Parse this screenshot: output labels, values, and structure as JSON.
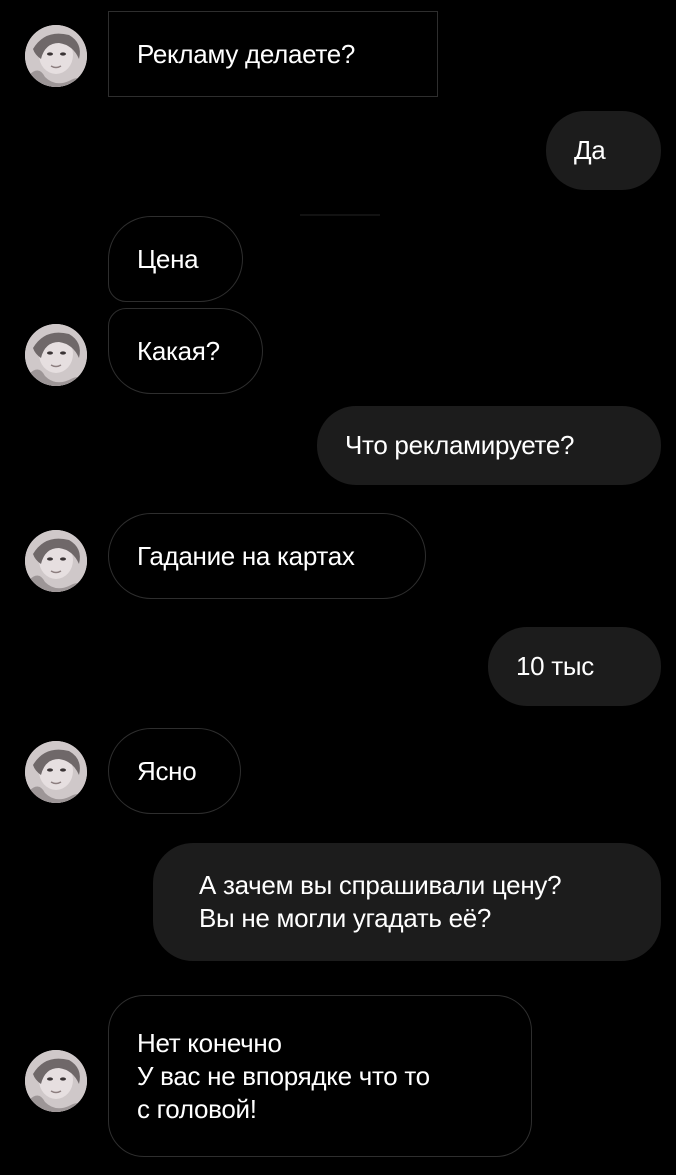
{
  "chat": {
    "messages": [
      {
        "from": "them",
        "text": "Рекламу делаете?"
      },
      {
        "from": "me",
        "text": "Да"
      },
      {
        "from": "them",
        "text": "Цена"
      },
      {
        "from": "them",
        "text": "Какая?"
      },
      {
        "from": "me",
        "text": "Что рекламируете?"
      },
      {
        "from": "them",
        "text": "Гадание на картах"
      },
      {
        "from": "me",
        "text": "10 тыс"
      },
      {
        "from": "them",
        "text": "Ясно"
      },
      {
        "from": "me",
        "text": "А зачем вы спрашивали цену?\nВы не могли угадать её?"
      },
      {
        "from": "them",
        "text": "Нет конечно\nУ вас не впорядке что то\nс головой!"
      }
    ]
  },
  "colors": {
    "background": "#000000",
    "incoming_border": "#2e2e2e",
    "outgoing_fill": "#1c1c1c",
    "text": "#ffffff"
  },
  "icons": {
    "avatar": "avatar-icon"
  }
}
